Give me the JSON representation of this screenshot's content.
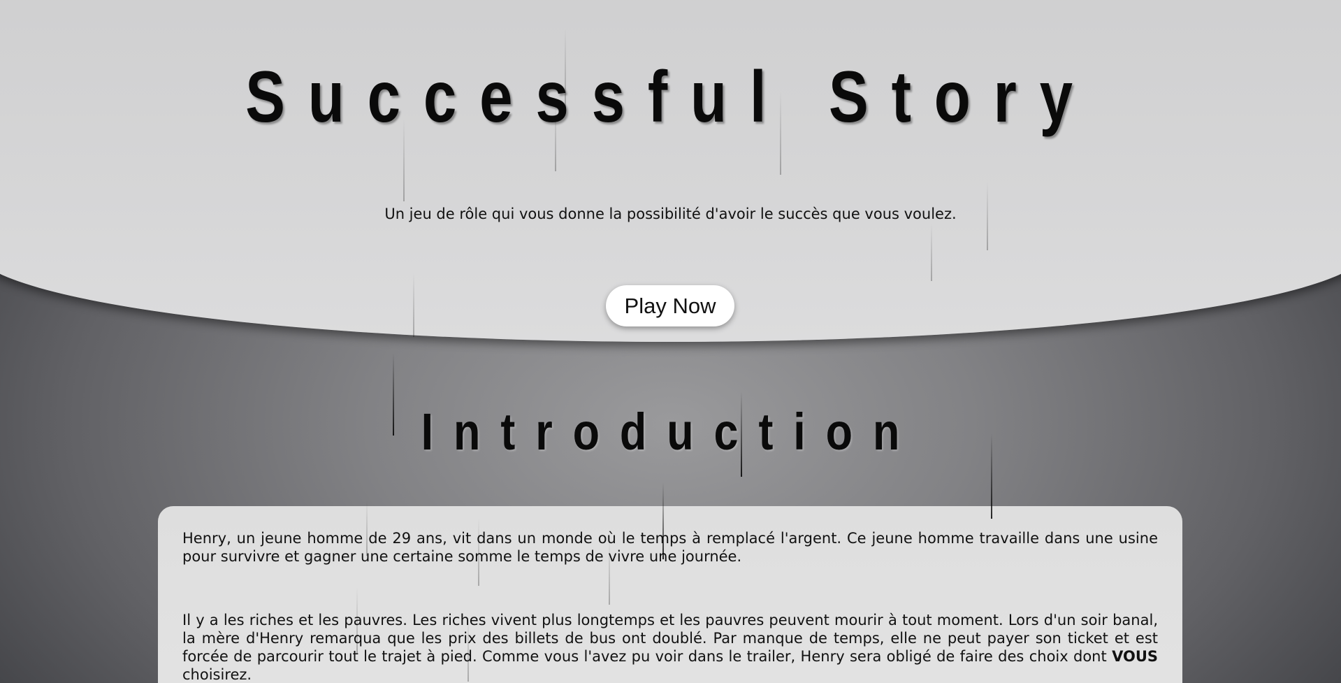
{
  "hero": {
    "title": "Successful Story",
    "subtitle": "Un jeu de rôle qui vous donne la possibilité d'avoir le succès que vous voulez.",
    "play_label": "Play Now"
  },
  "intro": {
    "heading": "Introduction",
    "paragraph1": "Henry, un jeune homme de 29 ans, vit dans un monde où le temps à remplacé l'argent. Ce jeune homme travaille dans une usine pour survivre et gagner une certaine somme le temps de vivre une journée.",
    "paragraph2_text": "Il y a les riches et les pauvres. Les riches vivent plus longtemps et les pauvres peuvent mourir à tout moment. Lors d'un soir banal, la mère d'Henry remarqua que les prix des billets de bus ont doublé. Par manque de temps, elle ne peut payer son ticket et est forcée de parcourir tout le trajet à pied. Comme vous l'avez pu voir dans le trailer, Henry sera obligé de faire des choix dont",
    "paragraph2_emphasis": "VOUS",
    "paragraph2_end": "choisirez."
  },
  "colors": {
    "hero_background": "#d4d4d5",
    "page_background": "#616165",
    "title_text": "#0a0a0a",
    "button_background": "#ffffff"
  }
}
